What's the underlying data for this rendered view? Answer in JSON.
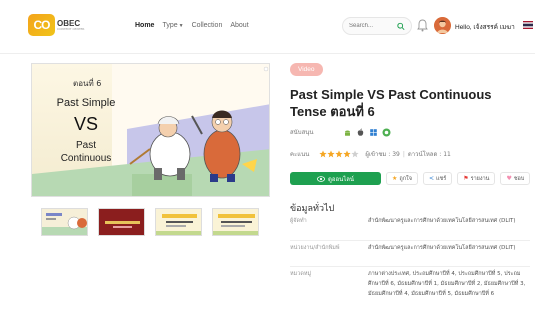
{
  "header": {
    "logo_mark": "CO",
    "logo_text": "OBEC",
    "logo_sub": "CONTENT CENTER",
    "nav": [
      {
        "label": "Home",
        "active": true
      },
      {
        "label": "Type",
        "has_caret": true
      },
      {
        "label": "Collection"
      },
      {
        "label": "About"
      }
    ],
    "search_placeholder": "Search...",
    "user_greeting": "Hello, เจ้งสรรค์ เมฆา"
  },
  "media": {
    "main_image": {
      "episode": "ตอนที่ 6",
      "line1": "Past Simple",
      "line2": "VS",
      "line3": "Past",
      "line4": "Continuous"
    },
    "thumbnails": [
      "thumb-1",
      "thumb-2",
      "thumb-3",
      "thumb-4"
    ]
  },
  "detail": {
    "badge": "Video",
    "title": "Past Simple VS Past Continuous Tense ตอนที่ 6",
    "support_label": "สนับสนุน",
    "rating_label": "คะแนน",
    "rating_value": 4,
    "rating_max": 5,
    "views": "ผู้เข้าชม : 39",
    "downloads": "ดาวน์โหลด : 11",
    "btn_view": "ดูออนไลน์",
    "btn_favorite": "ถูกใจ",
    "btn_share": "แชร์",
    "btn_report": "รายงาน",
    "btn_like": "ชอบ",
    "section_title": "ข้อมูลทั่วไป",
    "info": [
      {
        "key": "ผู้จัดทำ",
        "value": "สำนักพัฒนาครูและการศึกษาด้วยเทคโนโลยีสารสนเทศ (DLIT)"
      },
      {
        "key": "หน่วยงาน/สำนักพิมพ์",
        "value": "สำนักพัฒนาครูและการศึกษาด้วยเทคโนโลยีสารสนเทศ (DLIT)"
      },
      {
        "key": "หมวดหมู่",
        "value": "ภาษาต่างประเทศ, ประถมศึกษาปีที่ 4, ประถมศึกษาปีที่ 5, ประถมศึกษาปีที่ 6, มัธยมศึกษาปีที่ 1, มัธยมศึกษาปีที่ 2, มัธยมศึกษาปีที่ 3, มัธยมศึกษาปีที่ 4, มัธยมศึกษาปีที่ 5, มัธยมศึกษาปีที่ 6"
      }
    ]
  },
  "colors": {
    "accent_green": "#1ea050",
    "badge_pink": "#f6b7b1",
    "star_orange": "#f5a623",
    "logo_orange": "#f4a31b"
  }
}
